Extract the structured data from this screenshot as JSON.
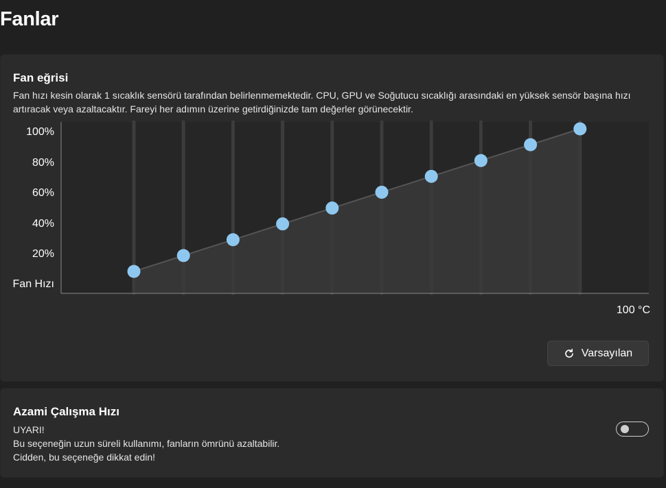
{
  "page": {
    "title": "Fanlar"
  },
  "fan_curve": {
    "title": "Fan eğrisi",
    "description": "Fan hızı kesin olarak 1 sıcaklık sensörü tarafından belirlenmemektedir. CPU, GPU ve Soğutucu sıcaklığı arasındaki en yüksek sensör başına hızı artıracak veya azaltacaktır. Fareyi her adımın üzerine getirdiğinizde tam değerler görünecektir.",
    "reset_label": "Varsayılan",
    "reset_icon": "refresh-icon",
    "colors": {
      "point": "#8ec8f0",
      "fill": "#3a3a3a",
      "line": "#555555"
    }
  },
  "chart_data": {
    "type": "line",
    "y_tick_labels": [
      "Fan Hızı",
      "20%",
      "40%",
      "60%",
      "80%",
      "100%"
    ],
    "y_ticks": [
      0,
      20,
      40,
      60,
      80,
      100
    ],
    "x_end_label": "100 °C",
    "x": [
      1,
      2,
      3,
      4,
      5,
      6,
      7,
      8,
      9,
      10
    ],
    "values": [
      10,
      20,
      30,
      40,
      50,
      60,
      70,
      80,
      90,
      100
    ],
    "ylim": [
      0,
      100
    ],
    "grid": true
  },
  "max_speed": {
    "title": "Azami Çalışma Hızı",
    "warning_lines": [
      "UYARI!",
      "Bu seçeneğin uzun süreli kullanımı, fanların ömrünü azaltabilir.",
      "Cidden, bu seçeneğe dikkat edin!"
    ],
    "toggle_on": false
  }
}
